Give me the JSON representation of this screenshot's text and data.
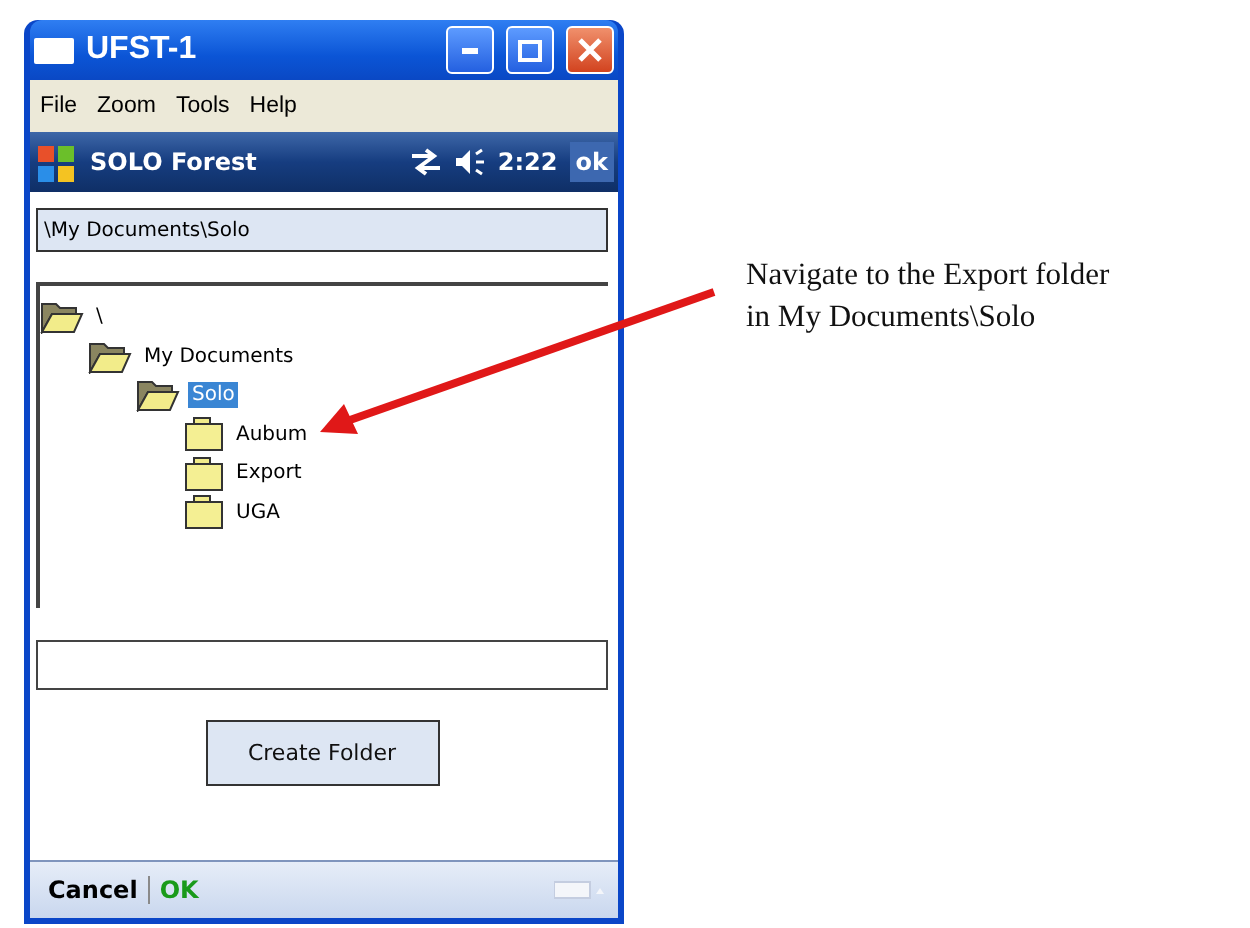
{
  "window": {
    "title": "UFST-1"
  },
  "menu": [
    "File",
    "Zoom",
    "Tools",
    "Help"
  ],
  "device_bar": {
    "title": "SOLO Forest",
    "time": "2:22",
    "ok": "ok"
  },
  "path_field": {
    "value": "\\My Documents\\Solo"
  },
  "tree": [
    {
      "label": "\\",
      "expanded": true,
      "selected": false,
      "children": [
        {
          "label": "My Documents",
          "expanded": true,
          "selected": false,
          "children": [
            {
              "label": "Solo",
              "expanded": true,
              "selected": true,
              "children": [
                {
                  "label": "Aubum",
                  "expanded": false,
                  "selected": false
                },
                {
                  "label": "Export",
                  "expanded": false,
                  "selected": false
                },
                {
                  "label": "UGA",
                  "expanded": false,
                  "selected": false
                }
              ]
            }
          ]
        }
      ]
    }
  ],
  "create_button": "Create Folder",
  "softkeys": [
    {
      "label": "Cancel",
      "kind": "cancel"
    },
    {
      "label": "OK",
      "kind": "ok"
    }
  ],
  "annotation": {
    "lines": [
      "Navigate to the Export folder",
      "in My Documents\\Solo"
    ]
  }
}
